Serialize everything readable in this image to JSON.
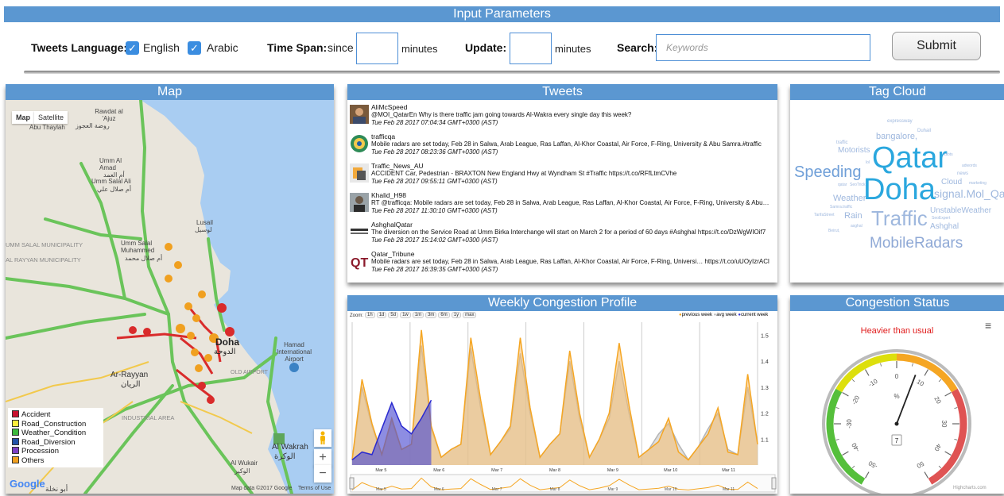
{
  "params": {
    "title": "Input Parameters",
    "lang_label": "Tweets Language:",
    "lang_english": "English",
    "lang_arabic": "Arabic",
    "timespan_label": "Time Span:",
    "timespan_since": "since",
    "minutes1": "minutes",
    "update_label": "Update:",
    "minutes2": "minutes",
    "search_label": "Search:",
    "search_placeholder": "Keywords",
    "submit": "Submit"
  },
  "map": {
    "title": "Map",
    "tab_map": "Map",
    "tab_satellite": "Satellite",
    "places": {
      "rawdat": "Rawdat al 'Ajuz",
      "rawdat_ar": "روضة العجوز",
      "abu_thaylah": "Abu Thaylah",
      "umm_al_amad": "Umm Al Amad",
      "umm_al_amad_ar": "أم العمد",
      "umm_salal_ali": "Umm Salal Ali",
      "umm_salal_ali_ar": "أم صلال علي",
      "lusail": "Lusail",
      "lusail_ar": "لوسيل",
      "umm_salal_muni": "UMM SALAL MUNICIPALITY",
      "al_rayyan_muni": "AL RAYYAN MUNICIPALITY",
      "umm_salal_muhammed": "Umm Salal Muhammed",
      "umm_salal_muhammed_ar": "أم صلال محمد",
      "doha": "Doha",
      "doha_ar": "الدوحة",
      "ar_rayyan": "Ar-Rayyan",
      "ar_rayyan_ar": "الريان",
      "hamad": "Hamad International Airport",
      "old_airport": "OLD AIRPORT",
      "industrial": "INDUSTRIAL AREA",
      "al_wakrah": "Al Wakrah",
      "al_wakrah_ar": "الوكرة",
      "al_wukair": "Al Wukair",
      "al_wukair_ar": "الوكير",
      "abu_nakhla": "أبو نخلة"
    },
    "legend": [
      {
        "label": "Accident",
        "color": "#c8102e"
      },
      {
        "label": "Road_Construction",
        "color": "#ffec3d"
      },
      {
        "label": "Weather_Condition",
        "color": "#3dba3d"
      },
      {
        "label": "Road_Diversion",
        "color": "#2253a8"
      },
      {
        "label": "Procession",
        "color": "#7b3fc4"
      },
      {
        "label": "Others",
        "color": "#f0a020"
      }
    ],
    "google": "Google",
    "data_credit": "Map data ©2017 Google",
    "terms": "Terms of Use"
  },
  "tweets": {
    "title": "Tweets",
    "items": [
      {
        "user": "AliMcSpeed",
        "text": "@MOI_QatarEn Why is there traffic jam going towards Al-Wakra every single day this week?",
        "time": "Tue Feb 28 2017 07:04:34 GMT+0300 (AST)"
      },
      {
        "user": "trafficqa",
        "text": "Mobile radars are set today, Feb 28 in Salwa, Arab League, Ras Laffan, Al-Khor Coastal, Air Force, F-Ring, University & Abu Samra.#traffic",
        "time": "Tue Feb 28 2017 08:23:36 GMT+0300 (AST)"
      },
      {
        "user": "Traffic_News_AU",
        "text": "ACCIDENT Car, Pedestrian - BRAXTON New England Hwy at Wyndham St #Traffic https://t.co/RFfLtmCVhe",
        "time": "Tue Feb 28 2017 09:55:11 GMT+0300 (AST)"
      },
      {
        "user": "Khalid_H98",
        "text": "RT @trafficqa: Mobile radars are set today, Feb 28 in Salwa, Arab League, Ras Laffan, Al-Khor Coastal, Air Force, F-Ring, University & Abu…",
        "time": "Tue Feb 28 2017 11:30:10 GMT+0300 (AST)"
      },
      {
        "user": "AshghalQatar",
        "text": "The diversion on the Service Road at Umm Birka Interchange will start on March 2 for a period of 60 days #Ashghal https://t.co/DzWgWIOif7",
        "time": "Tue Feb 28 2017 15:14:02 GMT+0300 (AST)"
      },
      {
        "user": "Qatar_Tribune",
        "text": "Mobile radars are set today, Feb 28 in Salwa, Arab League, Ras Laffan, Al-Khor Coastal, Air Force, F-Ring, Universi… https://t.co/uUOyIzrACl",
        "time": "Tue Feb 28 2017 16:39:35 GMT+0300 (AST)"
      }
    ]
  },
  "tagcloud": {
    "title": "Tag Cloud",
    "tags": [
      {
        "text": "expressway",
        "size": 6,
        "color": "#9fb8de"
      },
      {
        "text": "Duhail",
        "size": 6,
        "color": "#9fb8de"
      },
      {
        "text": "bangalore,",
        "size": 11,
        "color": "#9fb8de"
      },
      {
        "text": "traffic",
        "size": 6,
        "color": "#9fb8de"
      },
      {
        "text": "Motorists",
        "size": 10,
        "color": "#9fb8de"
      },
      {
        "text": "Qatar",
        "size": 38,
        "color": "#2aa7de"
      },
      {
        "text": "idiots",
        "size": 5,
        "color": "#9fb8de"
      },
      {
        "text": "adwords",
        "size": 5,
        "color": "#9fb8de"
      },
      {
        "text": "lol",
        "size": 5,
        "color": "#9fb8de"
      },
      {
        "text": "Speeding",
        "size": 20,
        "color": "#6f9fd8"
      },
      {
        "text": "news",
        "size": 6,
        "color": "#9fb8de"
      },
      {
        "text": "qatar",
        "size": 5,
        "color": "#9fb8de"
      },
      {
        "text": "SeoTrick",
        "size": 5,
        "color": "#9fb8de"
      },
      {
        "text": "Doha",
        "size": 38,
        "color": "#2aa7de"
      },
      {
        "text": "Cloud",
        "size": 10,
        "color": "#9fb8de"
      },
      {
        "text": "marketing",
        "size": 5,
        "color": "#9fb8de"
      },
      {
        "text": "Weather",
        "size": 11,
        "color": "#9fb8de"
      },
      {
        "text": "signal.Mol_Qa",
        "size": 14,
        "color": "#9fb8de"
      },
      {
        "text": "Samra.traffic",
        "size": 5,
        "color": "#9fb8de"
      },
      {
        "text": "Traffic",
        "size": 26,
        "color": "#9fb8de"
      },
      {
        "text": "UnstableWeather",
        "size": 10,
        "color": "#9fb8de"
      },
      {
        "text": "TarifaStreet",
        "size": 5,
        "color": "#9fb8de"
      },
      {
        "text": "Rain",
        "size": 11,
        "color": "#9fb8de"
      },
      {
        "text": "SeoExpert",
        "size": 5,
        "color": "#9fb8de"
      },
      {
        "text": "asghal",
        "size": 5,
        "color": "#9fb8de"
      },
      {
        "text": "Ashghal",
        "size": 10,
        "color": "#9fb8de"
      },
      {
        "text": "Beirut,",
        "size": 5,
        "color": "#9fb8de"
      },
      {
        "text": "MobileRadars",
        "size": 19,
        "color": "#8fa9d6"
      }
    ]
  },
  "weekly": {
    "title": "Weekly Congestion Profile",
    "zoom_label": "Zoom:",
    "zoom_buttons": [
      "1h",
      "1d",
      "5d",
      "1w",
      "1m",
      "3m",
      "6m",
      "1y",
      "max"
    ],
    "legend": [
      "previous week",
      "avg week",
      "current week"
    ],
    "colors": {
      "previous": "#f5a623",
      "avg": "#bbbbbb",
      "current": "#3b3bd6"
    }
  },
  "chart_data": {
    "type": "area",
    "title": "Weekly Congestion Profile",
    "x_labels": [
      "Mar 5",
      "Mar 6",
      "Mar 7",
      "Mar 8",
      "Mar 9",
      "Mar 10",
      "Mar 11"
    ],
    "ylim": [
      1.0,
      1.55
    ],
    "y_ticks": [
      1.1,
      1.2,
      1.3,
      1.4,
      1.5
    ],
    "series": [
      {
        "name": "previous week",
        "values": [
          1.02,
          1.33,
          1.16,
          1.04,
          1.18,
          1.06,
          1.08,
          1.52,
          1.15,
          1.03,
          1.06,
          1.08,
          1.49,
          1.25,
          1.04,
          1.09,
          1.15,
          1.49,
          1.22,
          1.03,
          1.08,
          1.12,
          1.44,
          1.2,
          1.03,
          1.1,
          1.2,
          1.47,
          1.23,
          1.03,
          1.06,
          1.09,
          1.18,
          1.05,
          1.02,
          1.07,
          1.12,
          1.22,
          1.05,
          1.04,
          1.35,
          1.08
        ]
      },
      {
        "name": "avg week",
        "values": [
          1.02,
          1.3,
          1.15,
          1.04,
          1.17,
          1.06,
          1.08,
          1.46,
          1.14,
          1.03,
          1.06,
          1.08,
          1.45,
          1.22,
          1.04,
          1.09,
          1.14,
          1.43,
          1.2,
          1.03,
          1.08,
          1.12,
          1.4,
          1.18,
          1.03,
          1.1,
          1.18,
          1.4,
          1.2,
          1.03,
          1.06,
          1.12,
          1.16,
          1.08,
          1.02,
          1.07,
          1.14,
          1.2,
          1.06,
          1.04,
          1.3,
          1.08
        ]
      },
      {
        "name": "current week",
        "values": [
          1.02,
          1.05,
          1.04,
          1.14,
          1.24,
          1.15,
          1.12,
          1.18,
          1.25
        ]
      }
    ],
    "legend_position": "top-right"
  },
  "status": {
    "title": "Congestion Status",
    "label": "Heavier than usual",
    "unit": "%",
    "value": 7,
    "value_text": "7",
    "dial_min": -50,
    "dial_max": 50,
    "ticks": [
      "-50",
      "-40",
      "-30",
      "-20",
      "-10",
      "0",
      "10",
      "20",
      "30",
      "40",
      "50"
    ],
    "credit": "Highcharts.com"
  }
}
